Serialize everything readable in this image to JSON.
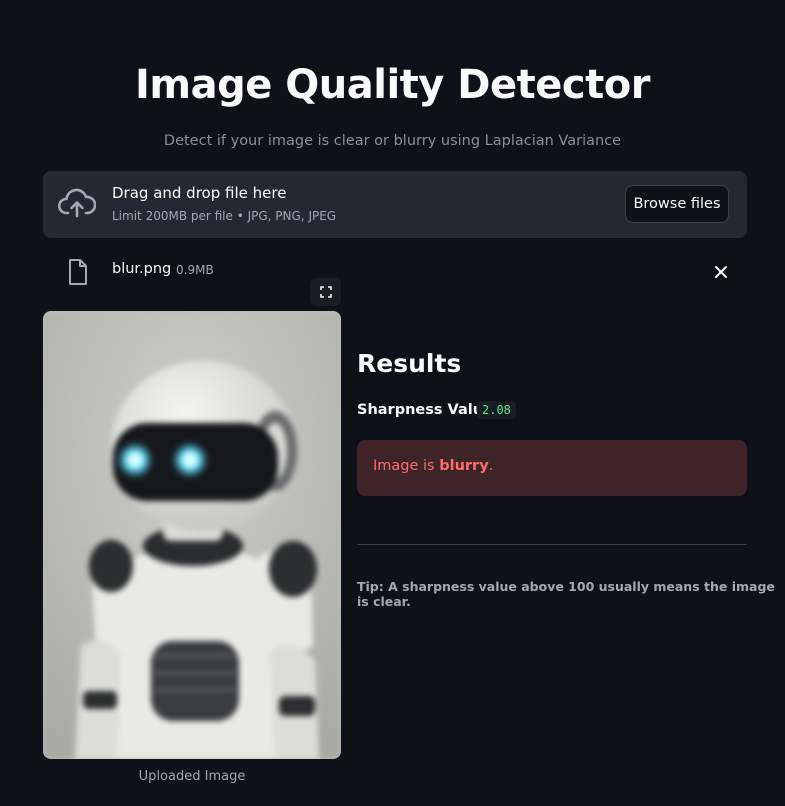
{
  "header": {
    "title": "Image Quality Detector",
    "subtitle": "Detect if your image is clear or blurry using Laplacian Variance"
  },
  "uploader": {
    "drop_text": "Drag and drop file here",
    "limit_text": "Limit 200MB per file • JPG, PNG, JPEG",
    "browse_label": "Browse files",
    "icon": "cloud-upload-icon"
  },
  "file": {
    "name": "blur.png",
    "size": "0.9MB",
    "icon": "file-icon",
    "remove_icon": "close-icon"
  },
  "image": {
    "caption": "Uploaded Image",
    "fullscreen_icon": "fullscreen-icon"
  },
  "results": {
    "heading": "Results",
    "sharpness_label": "Sharpness Value:",
    "sharpness_value": "2.08",
    "alert_prefix": "Image is ",
    "alert_status": "blurry",
    "alert_suffix": ".",
    "tip": "Tip: A sharpness value above 100 usually means the image is clear."
  },
  "colors": {
    "background": "#0e1117",
    "panel": "#262730",
    "error_bg": "#3e2428",
    "error_text": "#ff6c6c",
    "code_green": "#5ce488"
  }
}
